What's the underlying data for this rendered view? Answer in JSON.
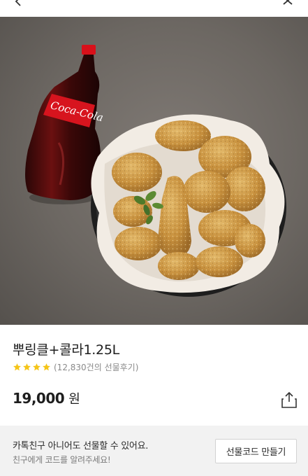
{
  "header": {
    "back_icon": "chevron-left-icon",
    "close_icon": "close-icon"
  },
  "hero_image": {
    "bottle_label": "Coca-Cola"
  },
  "product": {
    "title": "뿌링클+콜라1.25L",
    "rating_stars": 4,
    "review_text": "(12,830건의 선물후기)",
    "price": "19,000",
    "price_unit": "원",
    "star_color": "#f5c518"
  },
  "gift_panel": {
    "main_text": "카톡친구 아니어도 선물할 수 있어요.",
    "sub_text": "친구에게 코드를 알려주세요!",
    "button_label": "선물코드 만들기"
  }
}
